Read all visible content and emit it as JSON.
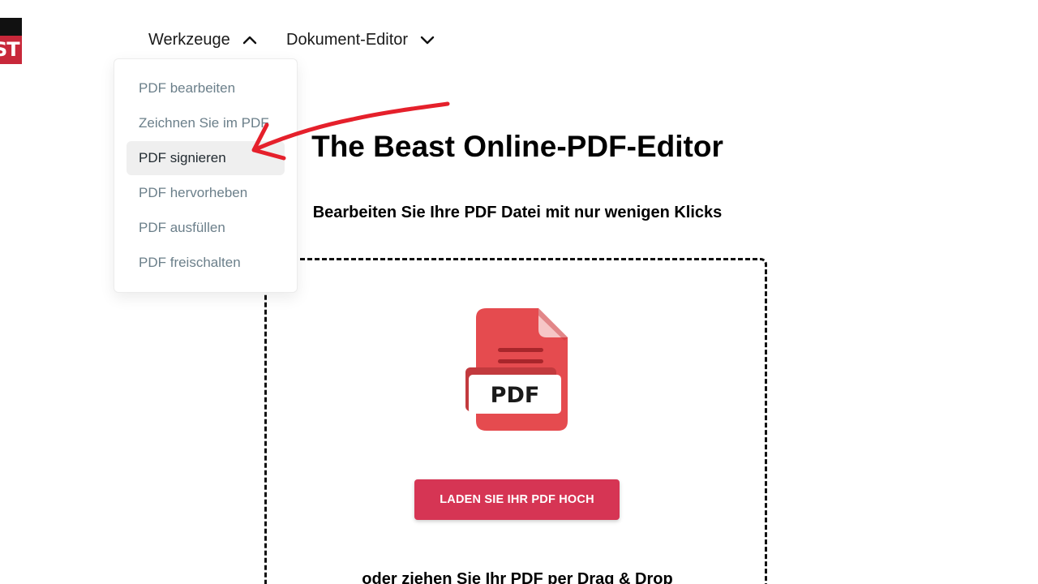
{
  "logo": {
    "text": "ST"
  },
  "nav": {
    "werkzeuge_label": "Werkzeuge",
    "editor_label": "Dokument-Editor"
  },
  "dropdown": {
    "items": [
      {
        "label": "PDF bearbeiten",
        "active": false
      },
      {
        "label": "Zeichnen Sie im PDF",
        "active": false
      },
      {
        "label": "PDF signieren",
        "active": true
      },
      {
        "label": "PDF hervorheben",
        "active": false
      },
      {
        "label": "PDF ausfüllen",
        "active": false
      },
      {
        "label": "PDF freischalten",
        "active": false
      }
    ]
  },
  "main": {
    "title": "The Beast Online-PDF-Editor",
    "subtitle": "Bearbeiten Sie Ihre PDF Datei mit nur wenigen Klicks",
    "pdf_icon_label": "PDF",
    "upload_button": "LADEN SIE IHR PDF HOCH",
    "drag_text": "oder ziehen Sie Ihr PDF per Drag & Drop"
  },
  "colors": {
    "brand_red": "#d63554",
    "pdf_icon_red": "#e54b4f",
    "annotation_red": "#e5202b",
    "active_item_bg": "#efefef",
    "menu_text": "#6b7f8a"
  },
  "icons": {
    "werkzeuge_chevron": "chevron-up-icon",
    "editor_chevron": "chevron-down-icon",
    "file": "pdf-file-icon",
    "annotation": "red-arrow-annotation"
  }
}
